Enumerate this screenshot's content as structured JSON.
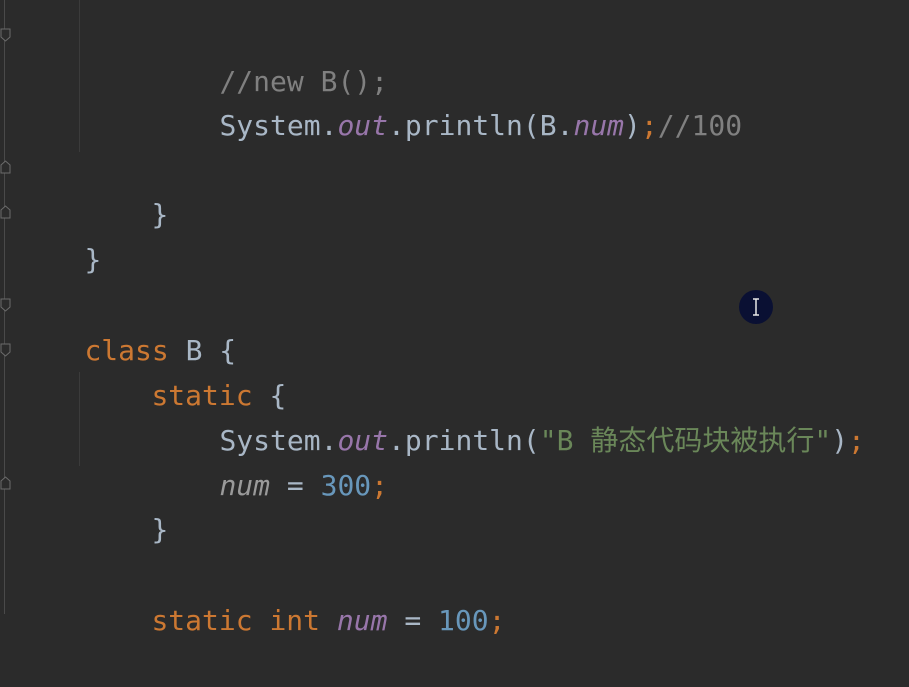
{
  "code": {
    "line_new_comment": "//new B();",
    "line_print_system": "System",
    "line_print_dot1": ".",
    "line_print_out": "out",
    "line_print_dot2": ".println(B.",
    "line_print_num": "num",
    "line_print_close": ")",
    "line_print_semi": ";",
    "line_print_comment": "//100",
    "line_close_inner": "}",
    "line_close_outer": "}",
    "class_kw": "class",
    "class_name": " B {",
    "static_kw": "static",
    "static_brace": " {",
    "print2_system": "System",
    "print2_dot1": ".",
    "print2_out": "out",
    "print2_dot2": ".println(",
    "print2_string": "\"B 静态代码块被执行\"",
    "print2_close": ")",
    "print2_semi": ";",
    "assign_num": "num",
    "assign_eq": " = ",
    "assign_value": "300",
    "assign_semi": ";",
    "static_block_close": "}",
    "decl_static": "static",
    "decl_int": "int",
    "decl_num": "num",
    "decl_eq": " = ",
    "decl_value": "100",
    "decl_semi": ";"
  },
  "cursor": {
    "icon": "text-cursor-icon"
  }
}
